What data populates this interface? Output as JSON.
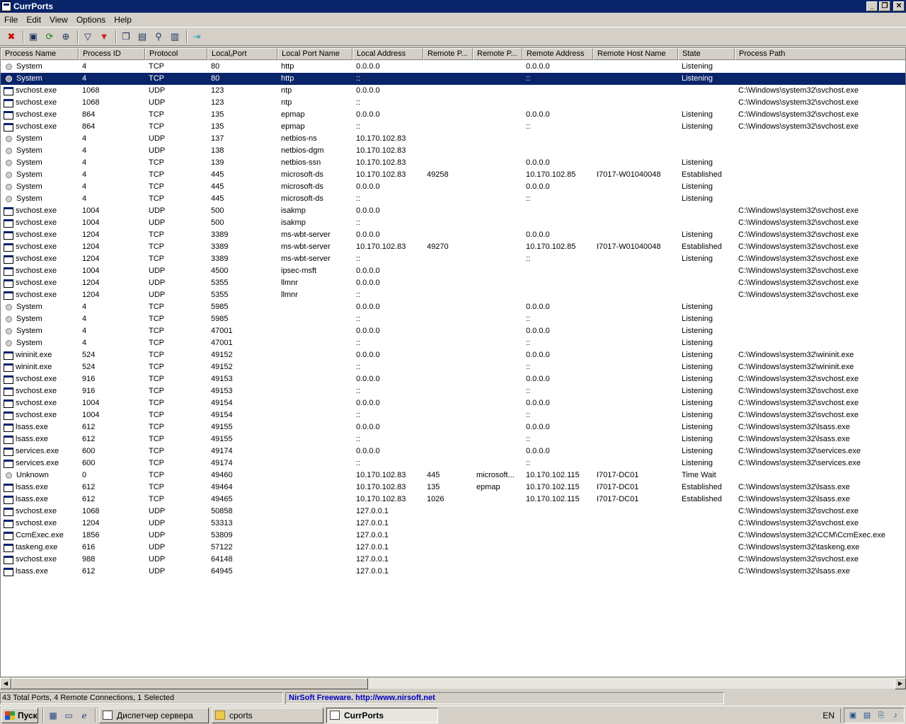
{
  "window": {
    "title": "CurrPorts"
  },
  "menu": [
    "File",
    "Edit",
    "View",
    "Options",
    "Help"
  ],
  "toolbar": [
    {
      "icon": "close-connection-icon",
      "glyph": "✖",
      "color": "#cc0000"
    },
    {
      "icon": "save-icon",
      "glyph": "▣",
      "color": "#203060"
    },
    {
      "icon": "refresh-icon",
      "glyph": "⟳",
      "color": "#208020"
    },
    {
      "icon": "properties-target-icon",
      "glyph": "⊕",
      "color": "#203060"
    },
    {
      "icon": "filter-icon",
      "glyph": "▽",
      "color": "#203060"
    },
    {
      "icon": "filter-red-icon",
      "glyph": "▼",
      "color": "#cc2020"
    },
    {
      "icon": "copy-icon",
      "glyph": "❐",
      "color": "#203060"
    },
    {
      "icon": "html-report-icon",
      "glyph": "▤",
      "color": "#203060"
    },
    {
      "icon": "find-icon",
      "glyph": "⚲",
      "color": "#203060"
    },
    {
      "icon": "report-icon",
      "glyph": "▥",
      "color": "#203060"
    },
    {
      "icon": "exit-icon",
      "glyph": "⇥",
      "color": "#20a0c0"
    }
  ],
  "columns": [
    {
      "label": "Process Name",
      "w": 110
    },
    {
      "label": "Process ID",
      "w": 94
    },
    {
      "label": "Protocol",
      "w": 88
    },
    {
      "label": "Local Port",
      "w": 99
    },
    {
      "label": "Local Port Name",
      "w": 106
    },
    {
      "label": "Local Address",
      "w": 100
    },
    {
      "label": "Remote P...",
      "w": 70
    },
    {
      "label": "Remote P...",
      "w": 70
    },
    {
      "label": "Remote Address",
      "w": 100
    },
    {
      "label": "Remote Host Name",
      "w": 120
    },
    {
      "label": "State",
      "w": 80
    },
    {
      "label": "Process Path",
      "w": 243
    }
  ],
  "sort": {
    "column": "Local Port",
    "direction": "ascending"
  },
  "rows": [
    [
      "System",
      "4",
      "TCP",
      "80",
      "http",
      "0.0.0.0",
      "",
      "",
      "0.0.0.0",
      "",
      "Listening",
      ""
    ],
    [
      "System",
      "4",
      "TCP",
      "80",
      "http",
      "::",
      "",
      "",
      "::",
      "",
      "Listening",
      ""
    ],
    [
      "svchost.exe",
      "1068",
      "UDP",
      "123",
      "ntp",
      "0.0.0.0",
      "",
      "",
      "",
      "",
      "",
      "C:\\Windows\\system32\\svchost.exe"
    ],
    [
      "svchost.exe",
      "1068",
      "UDP",
      "123",
      "ntp",
      "::",
      "",
      "",
      "",
      "",
      "",
      "C:\\Windows\\system32\\svchost.exe"
    ],
    [
      "svchost.exe",
      "864",
      "TCP",
      "135",
      "epmap",
      "0.0.0.0",
      "",
      "",
      "0.0.0.0",
      "",
      "Listening",
      "C:\\Windows\\system32\\svchost.exe"
    ],
    [
      "svchost.exe",
      "864",
      "TCP",
      "135",
      "epmap",
      "::",
      "",
      "",
      "::",
      "",
      "Listening",
      "C:\\Windows\\system32\\svchost.exe"
    ],
    [
      "System",
      "4",
      "UDP",
      "137",
      "netbios-ns",
      "10.170.102.83",
      "",
      "",
      "",
      "",
      "",
      ""
    ],
    [
      "System",
      "4",
      "UDP",
      "138",
      "netbios-dgm",
      "10.170.102.83",
      "",
      "",
      "",
      "",
      "",
      ""
    ],
    [
      "System",
      "4",
      "TCP",
      "139",
      "netbios-ssn",
      "10.170.102.83",
      "",
      "",
      "0.0.0.0",
      "",
      "Listening",
      ""
    ],
    [
      "System",
      "4",
      "TCP",
      "445",
      "microsoft-ds",
      "10.170.102.83",
      "49258",
      "",
      "10.170.102.85",
      "I7017-W01040048",
      "Established",
      ""
    ],
    [
      "System",
      "4",
      "TCP",
      "445",
      "microsoft-ds",
      "0.0.0.0",
      "",
      "",
      "0.0.0.0",
      "",
      "Listening",
      ""
    ],
    [
      "System",
      "4",
      "TCP",
      "445",
      "microsoft-ds",
      "::",
      "",
      "",
      "::",
      "",
      "Listening",
      ""
    ],
    [
      "svchost.exe",
      "1004",
      "UDP",
      "500",
      "isakmp",
      "0.0.0.0",
      "",
      "",
      "",
      "",
      "",
      "C:\\Windows\\system32\\svchost.exe"
    ],
    [
      "svchost.exe",
      "1004",
      "UDP",
      "500",
      "isakmp",
      "::",
      "",
      "",
      "",
      "",
      "",
      "C:\\Windows\\system32\\svchost.exe"
    ],
    [
      "svchost.exe",
      "1204",
      "TCP",
      "3389",
      "ms-wbt-server",
      "0.0.0.0",
      "",
      "",
      "0.0.0.0",
      "",
      "Listening",
      "C:\\Windows\\system32\\svchost.exe"
    ],
    [
      "svchost.exe",
      "1204",
      "TCP",
      "3389",
      "ms-wbt-server",
      "10.170.102.83",
      "49270",
      "",
      "10.170.102.85",
      "I7017-W01040048",
      "Established",
      "C:\\Windows\\system32\\svchost.exe"
    ],
    [
      "svchost.exe",
      "1204",
      "TCP",
      "3389",
      "ms-wbt-server",
      "::",
      "",
      "",
      "::",
      "",
      "Listening",
      "C:\\Windows\\system32\\svchost.exe"
    ],
    [
      "svchost.exe",
      "1004",
      "UDP",
      "4500",
      "ipsec-msft",
      "0.0.0.0",
      "",
      "",
      "",
      "",
      "",
      "C:\\Windows\\system32\\svchost.exe"
    ],
    [
      "svchost.exe",
      "1204",
      "UDP",
      "5355",
      "llmnr",
      "0.0.0.0",
      "",
      "",
      "",
      "",
      "",
      "C:\\Windows\\system32\\svchost.exe"
    ],
    [
      "svchost.exe",
      "1204",
      "UDP",
      "5355",
      "llmnr",
      "::",
      "",
      "",
      "",
      "",
      "",
      "C:\\Windows\\system32\\svchost.exe"
    ],
    [
      "System",
      "4",
      "TCP",
      "5985",
      "",
      "0.0.0.0",
      "",
      "",
      "0.0.0.0",
      "",
      "Listening",
      ""
    ],
    [
      "System",
      "4",
      "TCP",
      "5985",
      "",
      "::",
      "",
      "",
      "::",
      "",
      "Listening",
      ""
    ],
    [
      "System",
      "4",
      "TCP",
      "47001",
      "",
      "0.0.0.0",
      "",
      "",
      "0.0.0.0",
      "",
      "Listening",
      ""
    ],
    [
      "System",
      "4",
      "TCP",
      "47001",
      "",
      "::",
      "",
      "",
      "::",
      "",
      "Listening",
      ""
    ],
    [
      "wininit.exe",
      "524",
      "TCP",
      "49152",
      "",
      "0.0.0.0",
      "",
      "",
      "0.0.0.0",
      "",
      "Listening",
      "C:\\Windows\\system32\\wininit.exe"
    ],
    [
      "wininit.exe",
      "524",
      "TCP",
      "49152",
      "",
      "::",
      "",
      "",
      "::",
      "",
      "Listening",
      "C:\\Windows\\system32\\wininit.exe"
    ],
    [
      "svchost.exe",
      "916",
      "TCP",
      "49153",
      "",
      "0.0.0.0",
      "",
      "",
      "0.0.0.0",
      "",
      "Listening",
      "C:\\Windows\\system32\\svchost.exe"
    ],
    [
      "svchost.exe",
      "916",
      "TCP",
      "49153",
      "",
      "::",
      "",
      "",
      "::",
      "",
      "Listening",
      "C:\\Windows\\system32\\svchost.exe"
    ],
    [
      "svchost.exe",
      "1004",
      "TCP",
      "49154",
      "",
      "0.0.0.0",
      "",
      "",
      "0.0.0.0",
      "",
      "Listening",
      "C:\\Windows\\system32\\svchost.exe"
    ],
    [
      "svchost.exe",
      "1004",
      "TCP",
      "49154",
      "",
      "::",
      "",
      "",
      "::",
      "",
      "Listening",
      "C:\\Windows\\system32\\svchost.exe"
    ],
    [
      "lsass.exe",
      "612",
      "TCP",
      "49155",
      "",
      "0.0.0.0",
      "",
      "",
      "0.0.0.0",
      "",
      "Listening",
      "C:\\Windows\\system32\\lsass.exe"
    ],
    [
      "lsass.exe",
      "612",
      "TCP",
      "49155",
      "",
      "::",
      "",
      "",
      "::",
      "",
      "Listening",
      "C:\\Windows\\system32\\lsass.exe"
    ],
    [
      "services.exe",
      "600",
      "TCP",
      "49174",
      "",
      "0.0.0.0",
      "",
      "",
      "0.0.0.0",
      "",
      "Listening",
      "C:\\Windows\\system32\\services.exe"
    ],
    [
      "services.exe",
      "600",
      "TCP",
      "49174",
      "",
      "::",
      "",
      "",
      "::",
      "",
      "Listening",
      "C:\\Windows\\system32\\services.exe"
    ],
    [
      "Unknown",
      "0",
      "TCP",
      "49460",
      "",
      "10.170.102.83",
      "445",
      "microsoft...",
      "10.170.102.115",
      "I7017-DC01",
      "Time Wait",
      ""
    ],
    [
      "lsass.exe",
      "612",
      "TCP",
      "49464",
      "",
      "10.170.102.83",
      "135",
      "epmap",
      "10.170.102.115",
      "I7017-DC01",
      "Established",
      "C:\\Windows\\system32\\lsass.exe"
    ],
    [
      "lsass.exe",
      "612",
      "TCP",
      "49465",
      "",
      "10.170.102.83",
      "1026",
      "",
      "10.170.102.115",
      "I7017-DC01",
      "Established",
      "C:\\Windows\\system32\\lsass.exe"
    ],
    [
      "svchost.exe",
      "1068",
      "UDP",
      "50858",
      "",
      "127.0.0.1",
      "",
      "",
      "",
      "",
      "",
      "C:\\Windows\\system32\\svchost.exe"
    ],
    [
      "svchost.exe",
      "1204",
      "UDP",
      "53313",
      "",
      "127.0.0.1",
      "",
      "",
      "",
      "",
      "",
      "C:\\Windows\\system32\\svchost.exe"
    ],
    [
      "CcmExec.exe",
      "1856",
      "UDP",
      "53809",
      "",
      "127.0.0.1",
      "",
      "",
      "",
      "",
      "",
      "C:\\Windows\\system32\\CCM\\CcmExec.exe"
    ],
    [
      "taskeng.exe",
      "616",
      "UDP",
      "57122",
      "",
      "127.0.0.1",
      "",
      "",
      "",
      "",
      "",
      "C:\\Windows\\system32\\taskeng.exe"
    ],
    [
      "svchost.exe",
      "988",
      "UDP",
      "64148",
      "",
      "127.0.0.1",
      "",
      "",
      "",
      "",
      "",
      "C:\\Windows\\system32\\svchost.exe"
    ],
    [
      "lsass.exe",
      "612",
      "UDP",
      "64945",
      "",
      "127.0.0.1",
      "",
      "",
      "",
      "",
      "",
      "C:\\Windows\\system32\\lsass.exe"
    ]
  ],
  "selected_row": 1,
  "status": {
    "summary": "43 Total Ports, 4 Remote Connections, 1 Selected",
    "credit": "NirSoft Freeware.  http://www.nirsoft.net"
  },
  "taskbar": {
    "start": "Пуск",
    "tasks": [
      {
        "label": "Диспетчер сервера",
        "active": false,
        "icon": "server-manager-icon"
      },
      {
        "label": "cports",
        "active": false,
        "icon": "folder-icon"
      },
      {
        "label": "CurrPorts",
        "active": true,
        "icon": "currports-icon"
      }
    ],
    "language": "EN"
  }
}
